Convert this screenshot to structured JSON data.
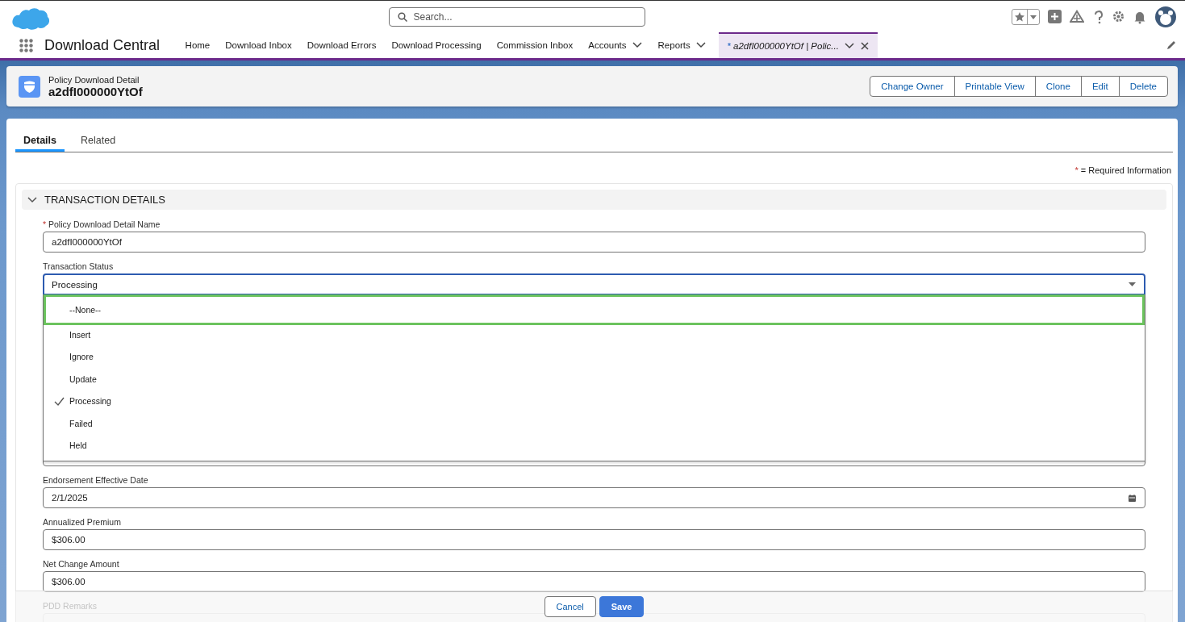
{
  "header": {
    "search": {
      "placeholder": "Search..."
    }
  },
  "nav": {
    "app_name": "Download Central",
    "items": [
      {
        "label": "Home",
        "has_menu": false,
        "selected": false
      },
      {
        "label": "Download Inbox",
        "has_menu": false,
        "selected": false
      },
      {
        "label": "Download Errors",
        "has_menu": false,
        "selected": false
      },
      {
        "label": "Download Processing",
        "has_menu": false,
        "selected": false
      },
      {
        "label": "Commission Inbox",
        "has_menu": false,
        "selected": false
      },
      {
        "label": "Accounts",
        "has_menu": true,
        "selected": false
      },
      {
        "label": "Reports",
        "has_menu": true,
        "selected": false
      }
    ],
    "workspace_tab": {
      "modified_mark": "*",
      "label": "a2dfI000000YtOf | Polic...",
      "selected": true
    }
  },
  "highlights": {
    "object_type": "Policy Download Detail",
    "title": "a2dfI000000YtOf",
    "buttons": [
      "Change Owner",
      "Printable View",
      "Clone",
      "Edit",
      "Delete"
    ]
  },
  "tabs": [
    {
      "label": "Details",
      "selected": true
    },
    {
      "label": "Related",
      "selected": false
    }
  ],
  "required_note": {
    "mark": "*",
    "text": "= Required Information"
  },
  "section": {
    "title": "TRANSACTION DETAILS",
    "expanded": true,
    "fields": [
      {
        "kind": "text",
        "label": "Policy Download Detail Name",
        "required": true,
        "value": "a2dfI000000YtOf"
      },
      {
        "kind": "picklist",
        "label": "Transaction Status",
        "required": false,
        "value": "Processing",
        "open": true,
        "options": [
          {
            "label": "--None--",
            "selected": false,
            "focused": true
          },
          {
            "label": "Insert",
            "selected": false,
            "focused": false
          },
          {
            "label": "Ignore",
            "selected": false,
            "focused": false
          },
          {
            "label": "Update",
            "selected": false,
            "focused": false
          },
          {
            "label": "Processing",
            "selected": true,
            "focused": false
          },
          {
            "label": "Failed",
            "selected": false,
            "focused": false
          },
          {
            "label": "Held",
            "selected": false,
            "focused": false
          }
        ]
      },
      {
        "kind": "covered"
      },
      {
        "kind": "date",
        "label": "Endorsement Effective Date",
        "required": false,
        "value": "2/1/2025"
      },
      {
        "kind": "text",
        "label": "Annualized Premium",
        "required": false,
        "value": "$306.00"
      },
      {
        "kind": "text",
        "label": "Net Change Amount",
        "required": false,
        "value": "$306.00"
      },
      {
        "kind": "faded",
        "label": "PDD Remarks",
        "required": false
      }
    ]
  },
  "footer": {
    "buttons": [
      {
        "label": "Cancel",
        "kind": "neutral"
      },
      {
        "label": "Save",
        "kind": "brand"
      }
    ]
  }
}
